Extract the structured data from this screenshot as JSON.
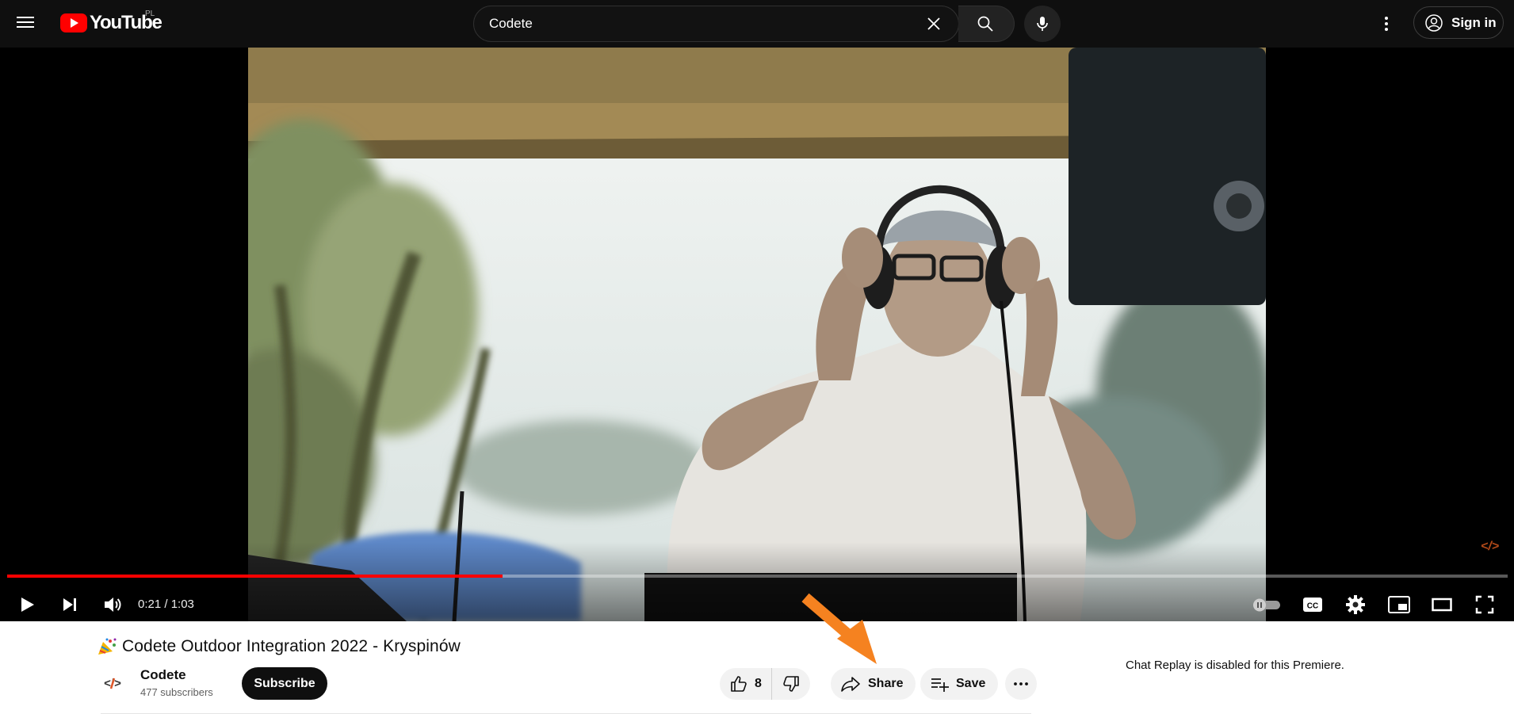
{
  "header": {
    "logo_text": "YouTube",
    "region": "PL",
    "search_value": "Codete",
    "sign_in_label": "Sign in"
  },
  "player": {
    "current_time": "0:21",
    "duration": "1:03",
    "time_display": "0:21 / 1:03",
    "progress_fraction": 0.33,
    "watermark": "</>"
  },
  "video": {
    "title": "Codete Outdoor Integration 2022 - Kryspinów",
    "likes": "8",
    "share_label": "Share",
    "save_label": "Save"
  },
  "channel": {
    "name": "Codete",
    "subscribers": "477 subscribers",
    "subscribe_label": "Subscribe"
  },
  "chat": {
    "note": "Chat Replay is disabled for this Premiere."
  },
  "colors": {
    "accent": "#ff0000",
    "annotation_arrow": "#f58220",
    "topbar": "#0f0f0f"
  }
}
